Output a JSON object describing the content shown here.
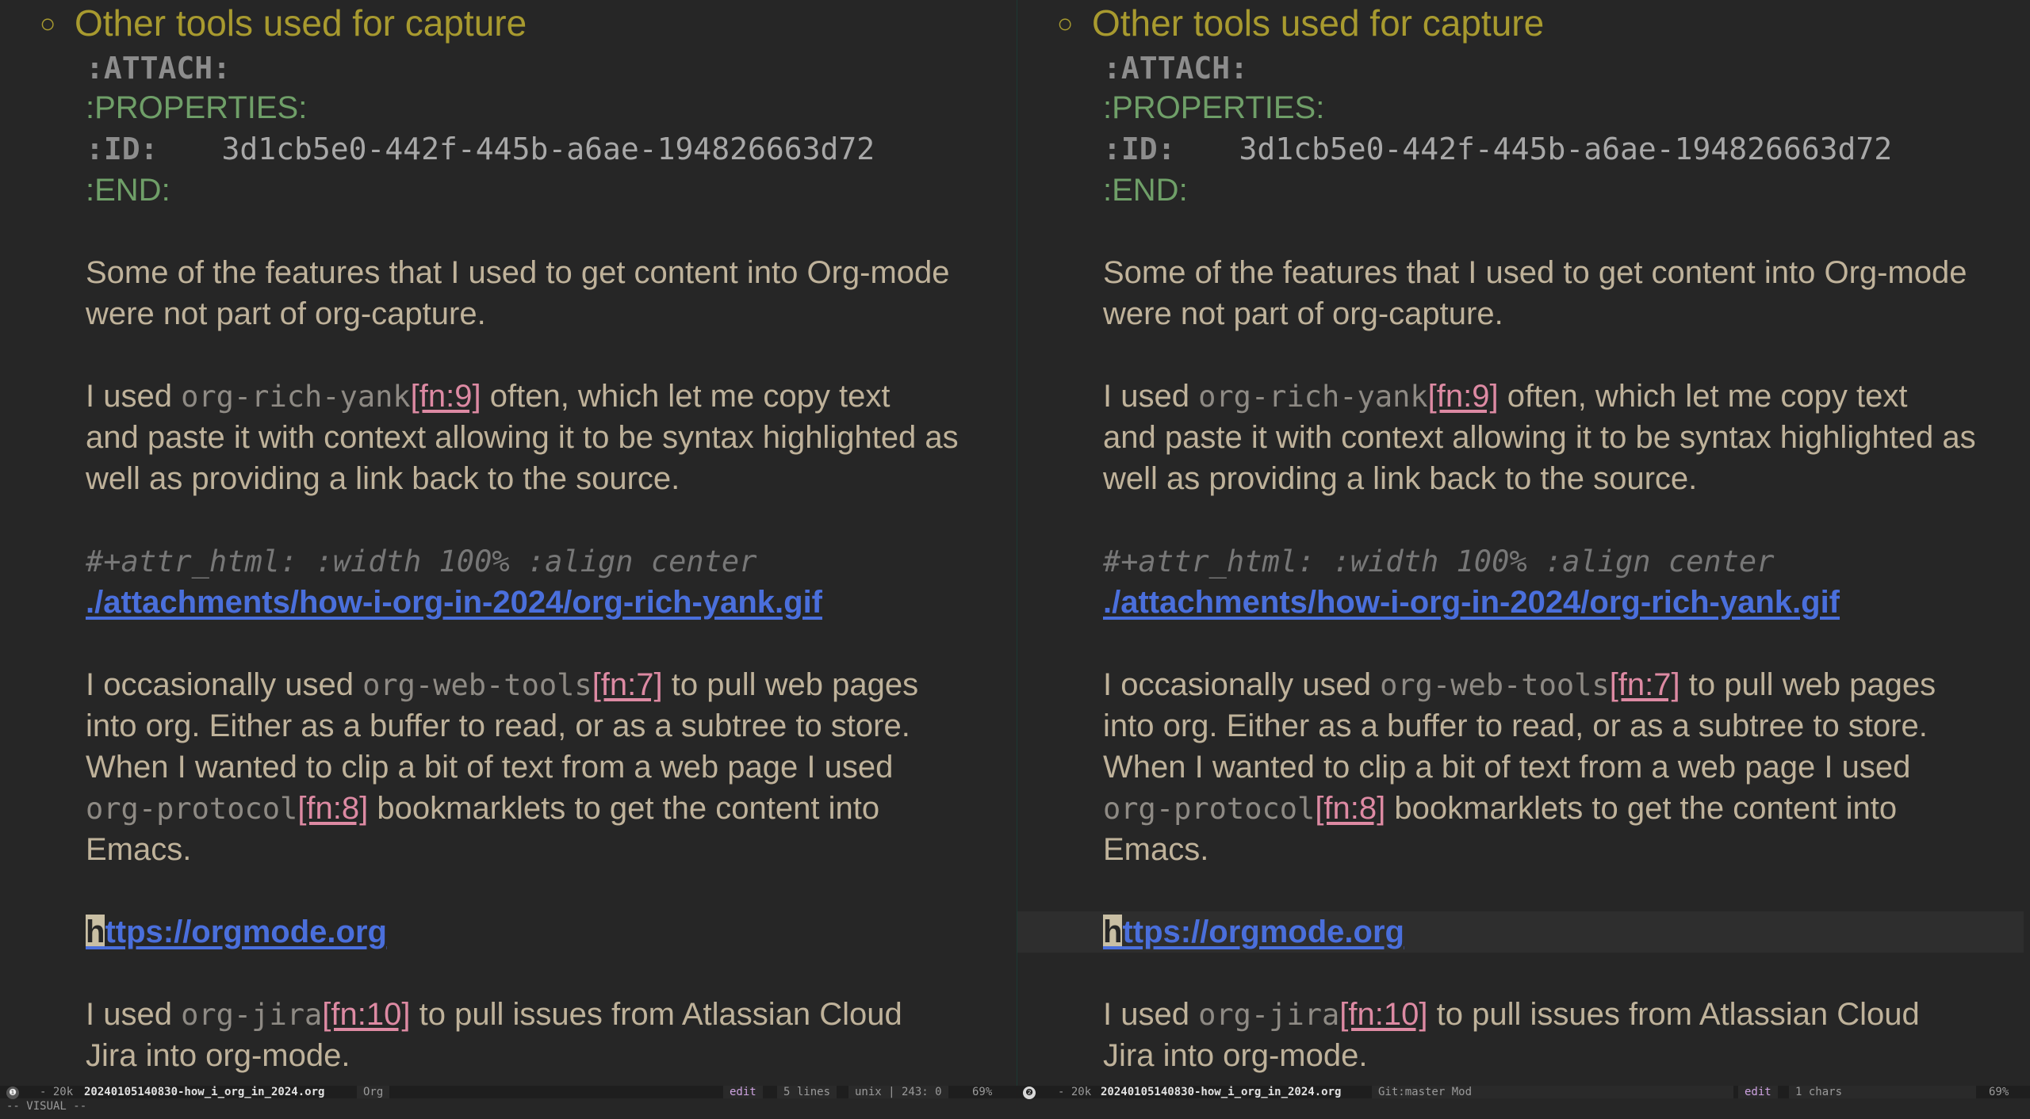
{
  "heading": "Other tools used for capture",
  "drawer": {
    "attach": ":ATTACH:",
    "properties": ":PROPERTIES:",
    "id_key": ":ID:",
    "id_value": "3d1cb5e0-442f-445b-a6ae-194826663d72",
    "end": ":END:"
  },
  "p1": [
    "Some of the features that I used to get content into Org-mode",
    "were not part of org-capture."
  ],
  "p2": {
    "l1_pre": "I used ",
    "l1_code": "org-rich-yank",
    "l1_fn": "[fn:9]",
    "l1_post": " often, which let me copy text",
    "l2": "and paste it with context allowing it to be syntax highlighted as",
    "l3": "well as providing a link back to the source."
  },
  "attr_html": "#+attr_html: :width 100% :align center",
  "gif_link": "./attachments/how-i-org-in-2024/org-rich-yank.gif",
  "p3": {
    "l1_pre": "I occasionally used ",
    "l1_code": "org-web-tools",
    "l1_fn": "[fn:7]",
    "l1_post": " to pull web pages",
    "l2": "into org. Either as a buffer to read, or as a subtree to store.",
    "l3": "When I wanted to clip a bit of text from a web page I used",
    "l4_code": "org-protocol",
    "l4_fn": "[fn:8]",
    "l4_post": " bookmarklets to get the content into",
    "l5": "Emacs."
  },
  "url": {
    "first": "h",
    "rest": "ttps://orgmode.org"
  },
  "p4": {
    "l1_pre": "I used ",
    "l1_code": "org-jira",
    "l1_fn": "[fn:10]",
    "l1_post_left": " to pull issues from Atlassian Cloud",
    "l2_left": "Jira into org-mode.",
    "l1_post_right": " to pull issues from Atlassian Cloud",
    "l2_right": "Jira into org-mode."
  },
  "statusbar": {
    "left": {
      "num": "❶",
      "size": "- 20k",
      "file": "20240105140830-how_i_org_in_2024.org",
      "major": "Org",
      "state": "edit",
      "selection": "5 lines",
      "encoding": "unix | 243: 0",
      "percent": "69%"
    },
    "right": {
      "num": "❷",
      "size": "- 20k",
      "file": "20240105140830-how_i_org_in_2024.org",
      "vcs": "Git:master Mod",
      "state": "edit",
      "selection": "1 chars",
      "percent": "69%"
    }
  },
  "minibuffer": "-- VISUAL --"
}
